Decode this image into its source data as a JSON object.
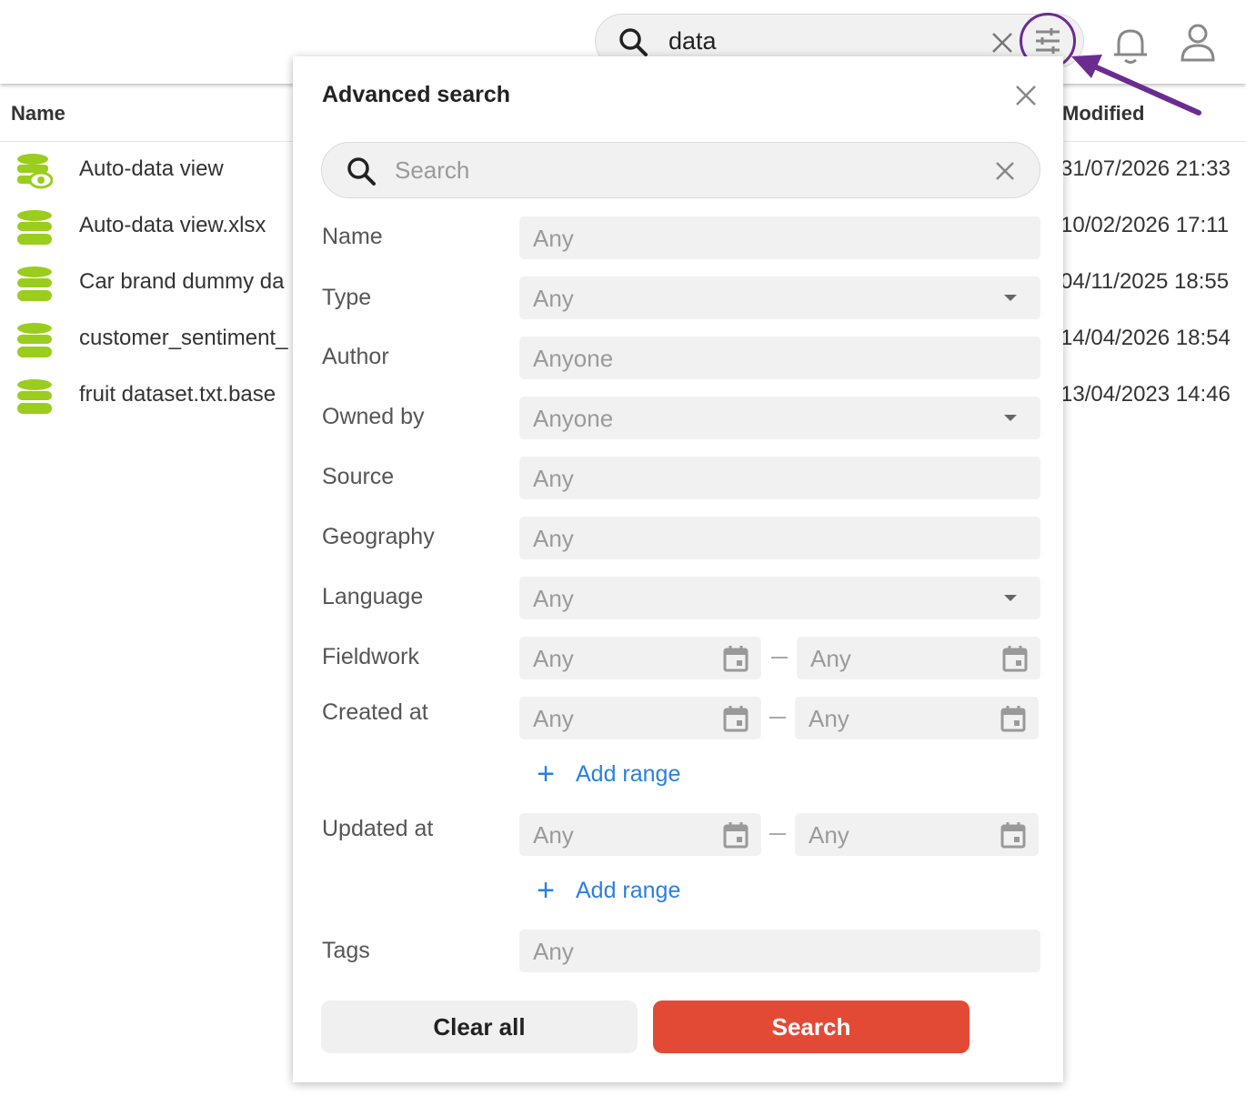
{
  "header": {
    "search_query": "data",
    "icons": {
      "search": "search-icon",
      "clear": "close-icon",
      "filter": "sliders-icon",
      "notifications": "bell-icon",
      "account": "user-icon"
    },
    "highlight_color": "#6a2c91"
  },
  "table": {
    "columns": {
      "name": "Name",
      "modified": "Modified"
    },
    "rows": [
      {
        "name": "Auto-data view",
        "modified": "31/07/2026 21:33",
        "icon": "database-view-icon"
      },
      {
        "name": "Auto-data view.xlsx",
        "modified": "10/02/2026 17:11",
        "icon": "database-icon"
      },
      {
        "name": "Car brand dummy da",
        "modified": "04/11/2025 18:55",
        "icon": "database-icon"
      },
      {
        "name": "customer_sentiment_",
        "modified": "14/04/2026 18:54",
        "icon": "database-icon"
      },
      {
        "name": "fruit dataset.txt.base",
        "modified": "13/04/2023 14:46",
        "icon": "database-icon"
      }
    ],
    "icon_color": "#9acd1e"
  },
  "advanced_search": {
    "title": "Advanced search",
    "search_placeholder": "Search",
    "fields": {
      "name": {
        "label": "Name",
        "value": "Any"
      },
      "type": {
        "label": "Type",
        "value": "Any"
      },
      "author": {
        "label": "Author",
        "value": "Anyone"
      },
      "owned_by": {
        "label": "Owned by",
        "value": "Anyone"
      },
      "source": {
        "label": "Source",
        "value": "Any"
      },
      "geography": {
        "label": "Geography",
        "value": "Any"
      },
      "language": {
        "label": "Language",
        "value": "Any"
      },
      "fieldwork": {
        "label": "Fieldwork",
        "from": "Any",
        "to": "Any"
      },
      "created_at": {
        "label": "Created at",
        "from": "Any",
        "to": "Any"
      },
      "updated_at": {
        "label": "Updated at",
        "from": "Any",
        "to": "Any"
      },
      "tags": {
        "label": "Tags",
        "value": "Any"
      }
    },
    "add_range_label": "Add range",
    "buttons": {
      "clear_all": "Clear all",
      "search": "Search"
    },
    "accent_color": "#e34a36",
    "link_color": "#2a7fe0"
  }
}
